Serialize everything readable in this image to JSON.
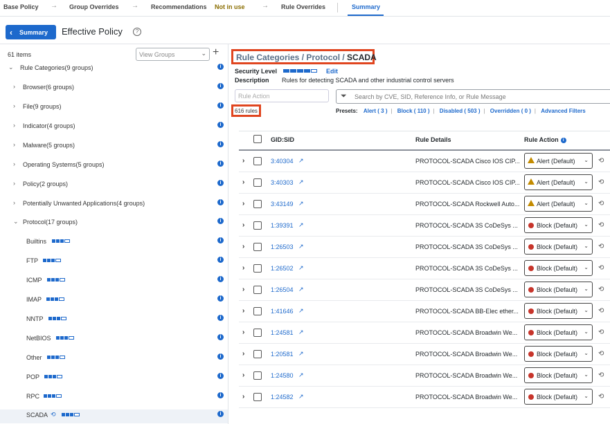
{
  "tabs": {
    "base_policy": "Base Policy",
    "group_overrides": "Group Overrides",
    "recommendations": "Recommendations",
    "not_in_use": "Not in use",
    "rule_overrides": "Rule Overrides",
    "summary": "Summary"
  },
  "header": {
    "back_label": "Summary",
    "title": "Effective Policy"
  },
  "left": {
    "items_count": "61 items",
    "view_groups_placeholder": "View Groups",
    "tree": [
      {
        "label": "Rule Categories(9 groups)",
        "expanded": true
      },
      {
        "label": "Browser(6 groups)"
      },
      {
        "label": "File(9 groups)"
      },
      {
        "label": "Indicator(4 groups)"
      },
      {
        "label": "Malware(5 groups)"
      },
      {
        "label": "Operating Systems(5 groups)"
      },
      {
        "label": "Policy(2 groups)"
      },
      {
        "label": "Potentially Unwanted Applications(4 groups)"
      },
      {
        "label": "Protocol(17 groups)",
        "expanded": true
      },
      {
        "label": "Builtins"
      },
      {
        "label": "FTP"
      },
      {
        "label": "ICMP"
      },
      {
        "label": "IMAP"
      },
      {
        "label": "NNTP"
      },
      {
        "label": "NetBIOS"
      },
      {
        "label": "Other"
      },
      {
        "label": "POP"
      },
      {
        "label": "RPC"
      },
      {
        "label": "SCADA",
        "selected": true
      }
    ]
  },
  "right": {
    "breadcrumb": {
      "path": "Rule Categories / Protocol / ",
      "current": "SCADA"
    },
    "security_level_label": "Security Level",
    "edit_label": "Edit",
    "description_label": "Description",
    "description_value": "Rules for detecting SCADA and other industrial control servers",
    "rule_action_placeholder": "Rule Action",
    "search_placeholder": "Search by CVE, SID, Reference Info, or Rule Message",
    "rules_count": "616 rules",
    "presets": {
      "label": "Presets:",
      "alert": "Alert ( 3 )",
      "block": "Block ( 110 )",
      "disabled": "Disabled ( 503 )",
      "overridden": "Overridden ( 0 )",
      "advanced": "Advanced Filters"
    },
    "columns": {
      "gid": "GID:SID",
      "details": "Rule Details",
      "action": "Rule Action"
    },
    "rows": [
      {
        "gid": "3:40304",
        "details": "PROTOCOL-SCADA Cisco IOS CIP...",
        "action": "Alert (Default)",
        "type": "alert"
      },
      {
        "gid": "3:40303",
        "details": "PROTOCOL-SCADA Cisco IOS CIP...",
        "action": "Alert (Default)",
        "type": "alert"
      },
      {
        "gid": "3:43149",
        "details": "PROTOCOL-SCADA Rockwell Auto...",
        "action": "Alert (Default)",
        "type": "alert"
      },
      {
        "gid": "1:39391",
        "details": "PROTOCOL-SCADA 3S CoDeSys ...",
        "action": "Block (Default)",
        "type": "block"
      },
      {
        "gid": "1:26503",
        "details": "PROTOCOL-SCADA 3S CoDeSys ...",
        "action": "Block (Default)",
        "type": "block"
      },
      {
        "gid": "1:26502",
        "details": "PROTOCOL-SCADA 3S CoDeSys ...",
        "action": "Block (Default)",
        "type": "block"
      },
      {
        "gid": "1:26504",
        "details": "PROTOCOL-SCADA 3S CoDeSys ...",
        "action": "Block (Default)",
        "type": "block"
      },
      {
        "gid": "1:41646",
        "details": "PROTOCOL-SCADA BB-Elec ether...",
        "action": "Block (Default)",
        "type": "block"
      },
      {
        "gid": "1:24581",
        "details": "PROTOCOL-SCADA Broadwin We...",
        "action": "Block (Default)",
        "type": "block"
      },
      {
        "gid": "1:20581",
        "details": "PROTOCOL-SCADA Broadwin We...",
        "action": "Block (Default)",
        "type": "block"
      },
      {
        "gid": "1:24580",
        "details": "PROTOCOL-SCADA Broadwin We...",
        "action": "Block (Default)",
        "type": "block"
      },
      {
        "gid": "1:24582",
        "details": "PROTOCOL-SCADA Broadwin We...",
        "action": "Block (Default)",
        "type": "block"
      }
    ]
  },
  "colors": {
    "accent": "#1d69cc",
    "highlight": "#e0451f",
    "alert": "#c38b00",
    "block": "#c7352b"
  }
}
